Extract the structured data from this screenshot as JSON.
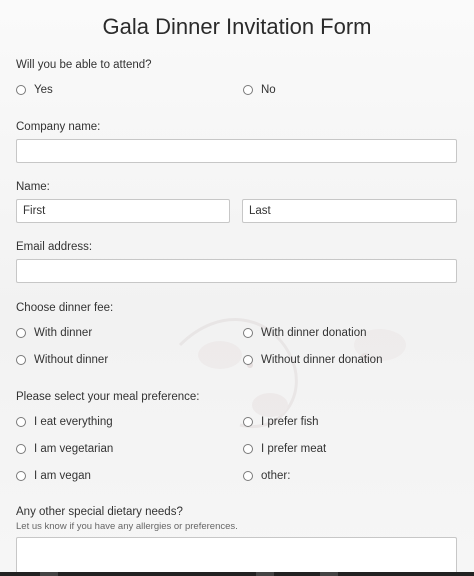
{
  "form": {
    "title": "Gala Dinner Invitation Form",
    "attend": {
      "question": "Will you be able to attend?",
      "options": [
        "Yes",
        "No"
      ]
    },
    "company": {
      "label": "Company name:",
      "value": ""
    },
    "name": {
      "label": "Name:",
      "first": "First",
      "last": "Last"
    },
    "email": {
      "label": "Email address:",
      "value": ""
    },
    "fee": {
      "question": "Choose dinner fee:",
      "options": [
        "With dinner",
        "With dinner donation",
        "Without dinner",
        "Without dinner donation"
      ]
    },
    "meal": {
      "question": "Please select your meal preference:",
      "options": [
        "I eat everything",
        "I prefer fish",
        "I am vegetarian",
        "I prefer meat",
        "I am vegan",
        "other:"
      ]
    },
    "dietary": {
      "question": "Any other special dietary needs?",
      "hint": "Let us know if you have any allergies or preferences.",
      "value": ""
    }
  },
  "colors": {
    "background": "#f4f4f4",
    "field_border": "#c7c7c7",
    "text": "#333333"
  }
}
